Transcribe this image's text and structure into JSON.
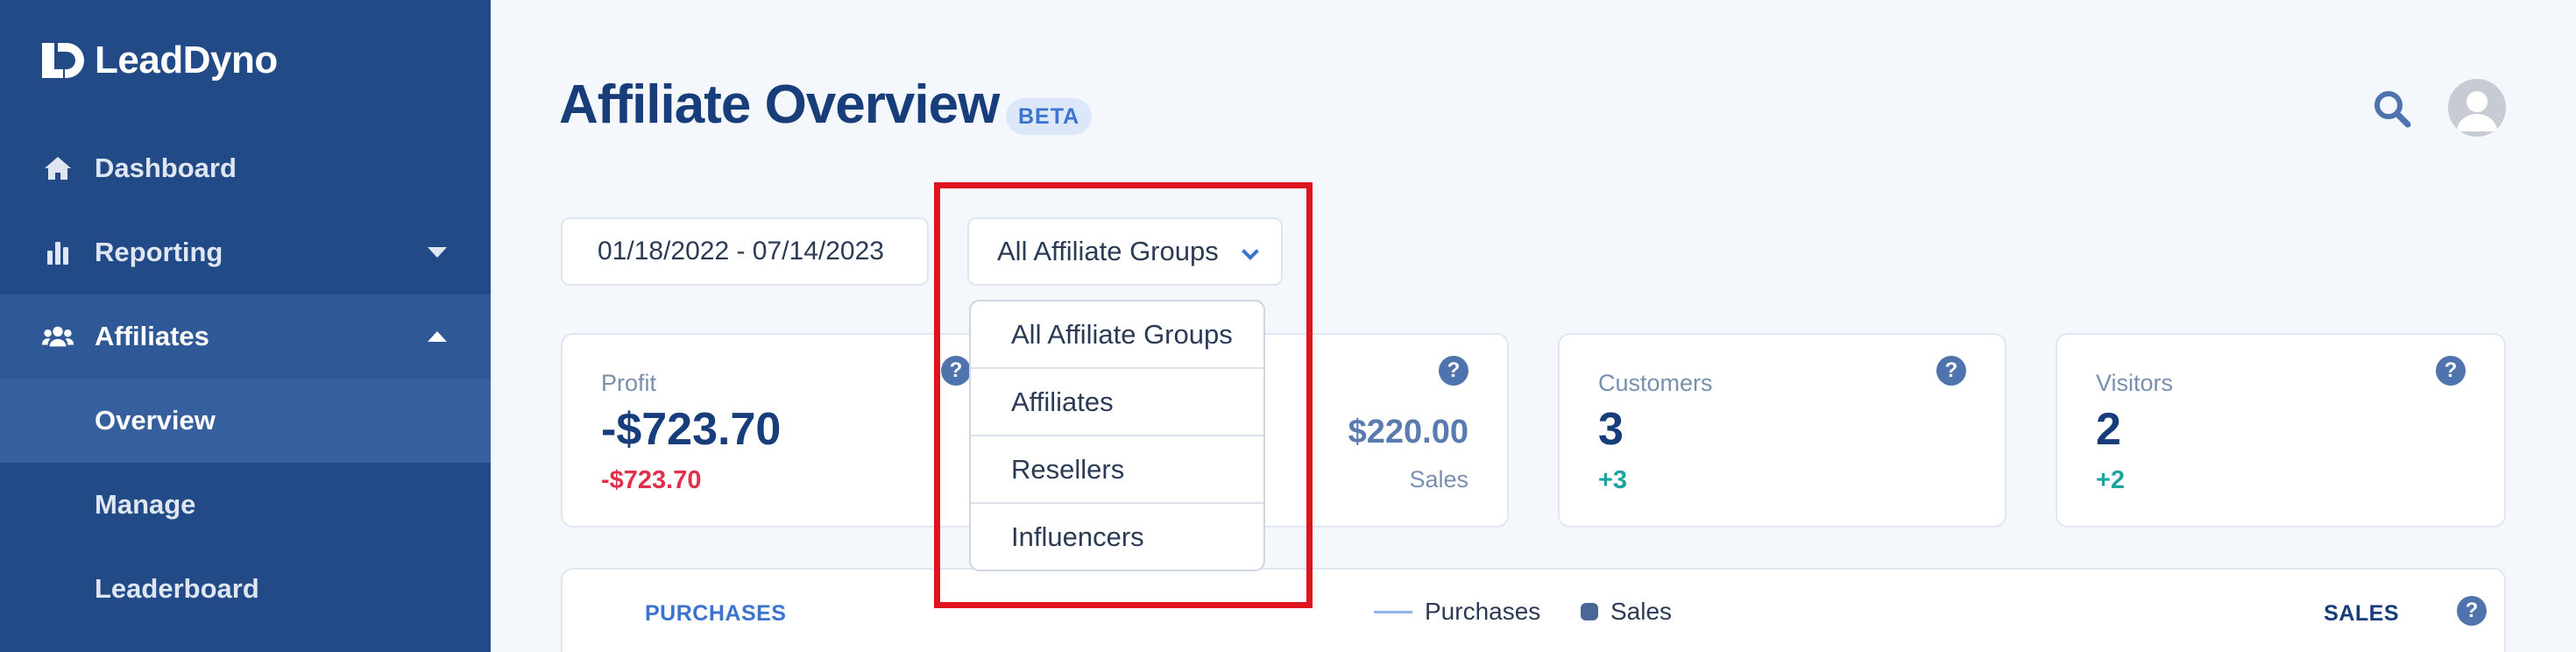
{
  "brand": {
    "name": "LeadDyno"
  },
  "sidebar": {
    "items": [
      {
        "label": "Dashboard",
        "icon": "home-icon"
      },
      {
        "label": "Reporting",
        "icon": "bar-chart-icon"
      },
      {
        "label": "Affiliates",
        "icon": "users-icon"
      },
      {
        "label": "Overview"
      },
      {
        "label": "Manage"
      },
      {
        "label": "Leaderboard"
      }
    ]
  },
  "header": {
    "title": "Affiliate Overview",
    "badge": "BETA"
  },
  "filters": {
    "date_range": "01/18/2022 - 07/14/2023",
    "group_selected": "All Affiliate Groups",
    "group_options": [
      "All Affiliate Groups",
      "Affiliates",
      "Resellers",
      "Influencers"
    ]
  },
  "cards": [
    {
      "label": "Profit",
      "value": "-$723.70",
      "delta": "-$723.70"
    },
    {
      "value": "$220.00",
      "sublabel": "Sales"
    },
    {
      "label": "Customers",
      "value": "3",
      "delta": "+3"
    },
    {
      "label": "Visitors",
      "value": "2",
      "delta": "+2"
    }
  ],
  "help_glyph": "?",
  "chart": {
    "tab_left": "PURCHASES",
    "legend": [
      "Purchases",
      "Sales"
    ],
    "tab_right": "SALES"
  },
  "colors": {
    "sidebar": "#224a86",
    "accent": "#3b74cf",
    "title": "#173d7a",
    "negative": "#e0304a",
    "positive": "#1ba3a0",
    "highlight": "#e0141e"
  }
}
